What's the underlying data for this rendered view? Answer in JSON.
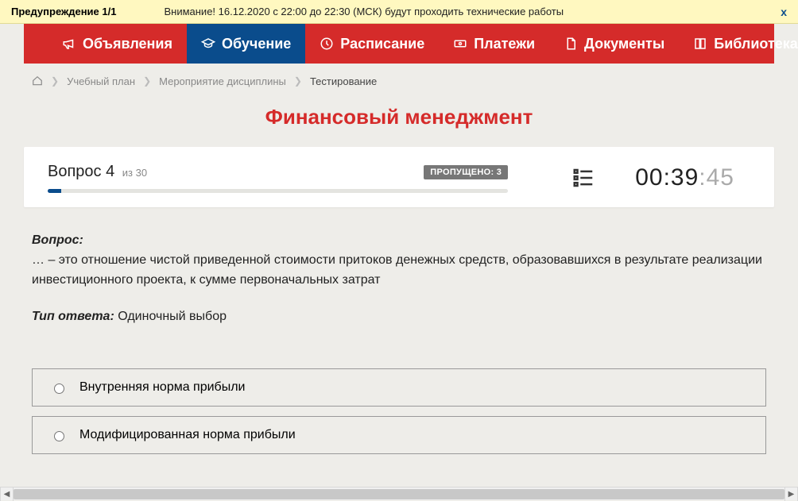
{
  "warning": {
    "title": "Предупреждение 1/1",
    "text": "Внимание! 16.12.2020 с 22:00 до 22:30 (МСК) будут проходить технические работы",
    "close": "x"
  },
  "nav": {
    "items": [
      {
        "label": "Объявления",
        "icon": "megaphone-icon",
        "active": false
      },
      {
        "label": "Обучение",
        "icon": "graduation-icon",
        "active": true
      },
      {
        "label": "Расписание",
        "icon": "clock-icon",
        "active": false
      },
      {
        "label": "Платежи",
        "icon": "money-icon",
        "active": false
      },
      {
        "label": "Документы",
        "icon": "document-icon",
        "active": false
      },
      {
        "label": "Библиотека",
        "icon": "book-icon",
        "active": false,
        "caret": true
      }
    ]
  },
  "breadcrumb": {
    "items": [
      {
        "label": "Учебный план",
        "current": false
      },
      {
        "label": "Мероприятие дисциплины",
        "current": false
      },
      {
        "label": "Тестирование",
        "current": true
      }
    ]
  },
  "page_title": "Финансовый менеджмент",
  "status": {
    "question_label": "Вопрос",
    "question_number": "4",
    "of_label": "из 30",
    "skipped_label": "ПРОПУЩЕНО: 3",
    "timer": {
      "mm": "00",
      "ss1": "39",
      "ss2": "45"
    }
  },
  "question": {
    "label": "Вопрос:",
    "text": "… – это отношение чистой приведенной стоимости притоков денежных средств, образовавшихся в результате реализации инвестиционного проекта, к сумме первоначальных затрат",
    "answer_type_label": "Тип ответа:",
    "answer_type_value": "Одиночный выбор"
  },
  "answers": [
    {
      "text": "Внутренняя норма прибыли"
    },
    {
      "text": "Модифицированная норма прибыли"
    }
  ]
}
